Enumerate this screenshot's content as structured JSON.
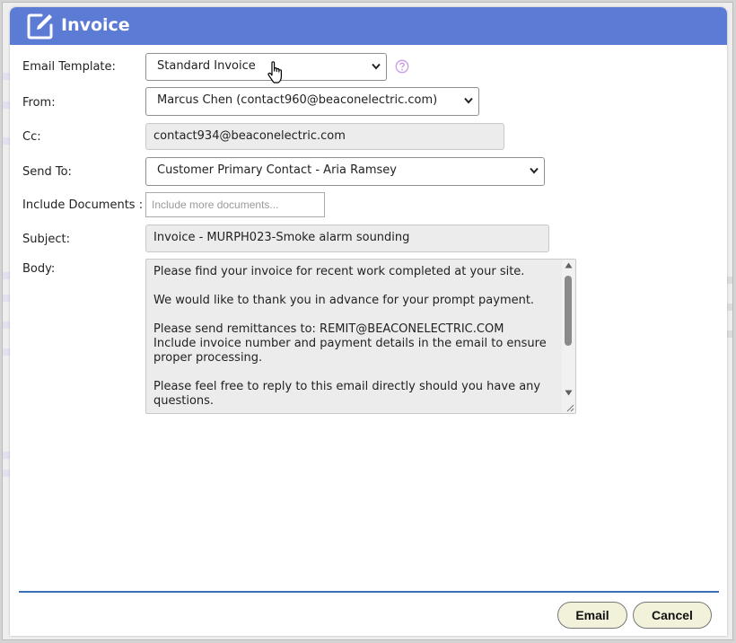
{
  "dialog": {
    "title": "Invoice",
    "title_icon": "edit-icon"
  },
  "form": {
    "email_template": {
      "label": "Email Template:",
      "value": "Standard Invoice"
    },
    "from": {
      "label": "From:",
      "value": "Marcus Chen (contact960@beaconelectric.com)"
    },
    "cc": {
      "label": "Cc:",
      "value": "contact934@beaconelectric.com"
    },
    "send_to": {
      "label": "Send To:",
      "value": "Customer Primary Contact - Aria Ramsey"
    },
    "include_documents": {
      "label": "Include Documents :",
      "placeholder": "Include more documents..."
    },
    "subject": {
      "label": "Subject:",
      "value": "Invoice - MURPH023-Smoke alarm sounding"
    },
    "body": {
      "label": "Body:",
      "paragraphs": [
        "Please find your invoice for recent work completed at your site.",
        "We would like to thank you in advance for your prompt payment.",
        "Please send remittances to: REMIT@BEACONELECTRIC.COM",
        "Include invoice number and payment details in the email to ensure proper processing.",
        "Please feel free to reply to this email directly should you have any questions."
      ]
    }
  },
  "footer": {
    "email_label": "Email",
    "cancel_label": "Cancel"
  },
  "colors": {
    "titlebar": "#5b7bd5",
    "footer_line": "#3a6fb5",
    "button_bg": "#f2f2da",
    "help_icon": "#c79be6"
  }
}
